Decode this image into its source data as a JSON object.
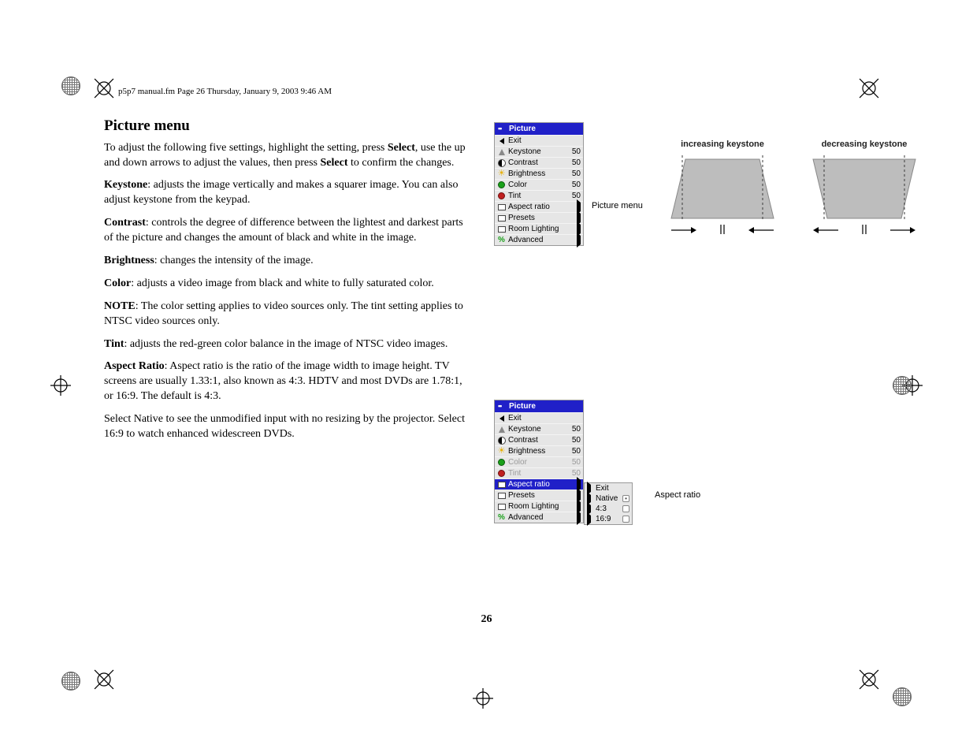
{
  "header_note": "p5p7 manual.fm  Page 26  Thursday, January 9, 2003  9:46 AM",
  "title": "Picture menu",
  "para_intro_a": "To adjust the following five settings, highlight the setting, press ",
  "para_intro_b": "Select",
  "para_intro_c": ", use the up and down arrows to adjust the values, then press ",
  "para_intro_d": "Select",
  "para_intro_e": " to confirm the changes.",
  "keystone_label": "Keystone",
  "keystone_text": ": adjusts the image vertically and makes a squarer image. You can also adjust keystone from the keypad.",
  "contrast_label": "Contrast",
  "contrast_text": ": controls the degree of difference between the lightest and darkest parts of the picture and changes the amount of black and white in the image.",
  "brightness_label": "Brightness",
  "brightness_text": ": changes the intensity of the image.",
  "color_label": "Color",
  "color_text": ": adjusts a video image from black and white to fully saturated color.",
  "note_label": "NOTE",
  "note_text": ": The color setting applies to video sources only. The tint setting applies to NTSC video sources only.",
  "tint_label": "Tint",
  "tint_text": ": adjusts the red-green color balance in the image of NTSC video images.",
  "aspect_label": "Aspect Ratio",
  "aspect_text": ": Aspect ratio is the ratio of the image width to image height. TV screens are usually 1.33:1, also known as 4:3. HDTV and most DVDs are 1.78:1, or 16:9. The default is 4:3.",
  "native_text": "Select Native to see the unmodified input with no resizing by the projector. Select 16:9 to watch enhanced widescreen DVDs.",
  "page_number": "26",
  "menu1": {
    "title": "Picture",
    "caption": "Picture menu",
    "items": [
      {
        "label": "Exit",
        "val": "",
        "icon": "back"
      },
      {
        "label": "Keystone",
        "val": "50",
        "icon": "keystone"
      },
      {
        "label": "Contrast",
        "val": "50",
        "icon": "half"
      },
      {
        "label": "Brightness",
        "val": "50",
        "icon": "sun"
      },
      {
        "label": "Color",
        "val": "50",
        "icon": "green"
      },
      {
        "label": "Tint",
        "val": "50",
        "icon": "red"
      },
      {
        "label": "Aspect ratio",
        "val": "▸",
        "icon": "rect"
      },
      {
        "label": "Presets",
        "val": "▸",
        "icon": "rect"
      },
      {
        "label": "Room Lighting",
        "val": "▸",
        "icon": "rect"
      },
      {
        "label": "Advanced",
        "val": "▸",
        "icon": "z"
      }
    ]
  },
  "keystone_diag": {
    "inc_title": "increasing keystone",
    "dec_title": "decreasing keystone"
  },
  "menu2": {
    "title": "Picture",
    "caption": "Aspect ratio",
    "items": [
      {
        "label": "Exit",
        "val": "",
        "icon": "back"
      },
      {
        "label": "Keystone",
        "val": "50",
        "icon": "keystone"
      },
      {
        "label": "Contrast",
        "val": "50",
        "icon": "half"
      },
      {
        "label": "Brightness",
        "val": "50",
        "icon": "sun"
      },
      {
        "label": "Color",
        "val": "50",
        "icon": "green",
        "dim": true
      },
      {
        "label": "Tint",
        "val": "50",
        "icon": "red",
        "dim": true
      },
      {
        "label": "Aspect ratio",
        "val": "▸",
        "icon": "rect",
        "hl": true
      },
      {
        "label": "Presets",
        "val": "▸",
        "icon": "rect"
      },
      {
        "label": "Room Lighting",
        "val": "▸",
        "icon": "rect"
      },
      {
        "label": "Advanced",
        "val": "▸",
        "icon": "z"
      }
    ],
    "submenu": [
      {
        "label": "Exit",
        "radio": false
      },
      {
        "label": "Native",
        "radio": true,
        "on": true
      },
      {
        "label": "4:3",
        "radio": true,
        "on": false
      },
      {
        "label": "16:9",
        "radio": true,
        "on": false
      }
    ]
  }
}
